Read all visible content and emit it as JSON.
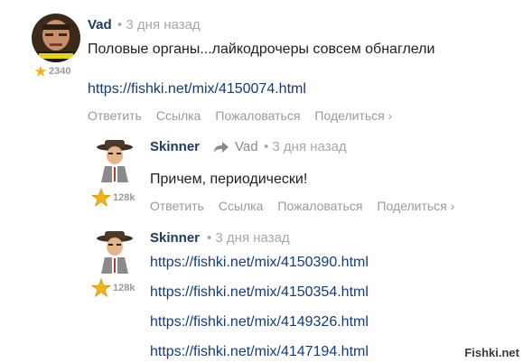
{
  "comments": [
    {
      "username": "Vad",
      "time": "• 3 дня назад",
      "rating": "2340",
      "text": "Половые органы...лайкодрочеры совсем обнаглели",
      "link": "https://fishki.net/mix/4150074.html",
      "actions": [
        "Ответить",
        "Ссылка",
        "Пожаловаться",
        "Поделиться ›"
      ]
    },
    {
      "username": "Skinner",
      "reply_to": "Vad",
      "time": "• 3 дня назад",
      "rating": "128k",
      "text": "Причем, периодически!",
      "actions": [
        "Ответить",
        "Ссылка",
        "Пожаловаться",
        "Поделиться ›"
      ]
    },
    {
      "username": "Skinner",
      "time": "• 3 дня назад",
      "rating": "128k",
      "links": [
        "https://fishki.net/mix/4150390.html",
        "https://fishki.net/mix/4150354.html",
        "https://fishki.net/mix/4149326.html",
        "https://fishki.net/mix/4147194.html"
      ]
    }
  ],
  "watermark": "Fishki.net",
  "colors": {
    "username": "#1e3a5c",
    "link": "#163b78",
    "meta": "#a8a8a8",
    "star": "#f2b21c"
  }
}
